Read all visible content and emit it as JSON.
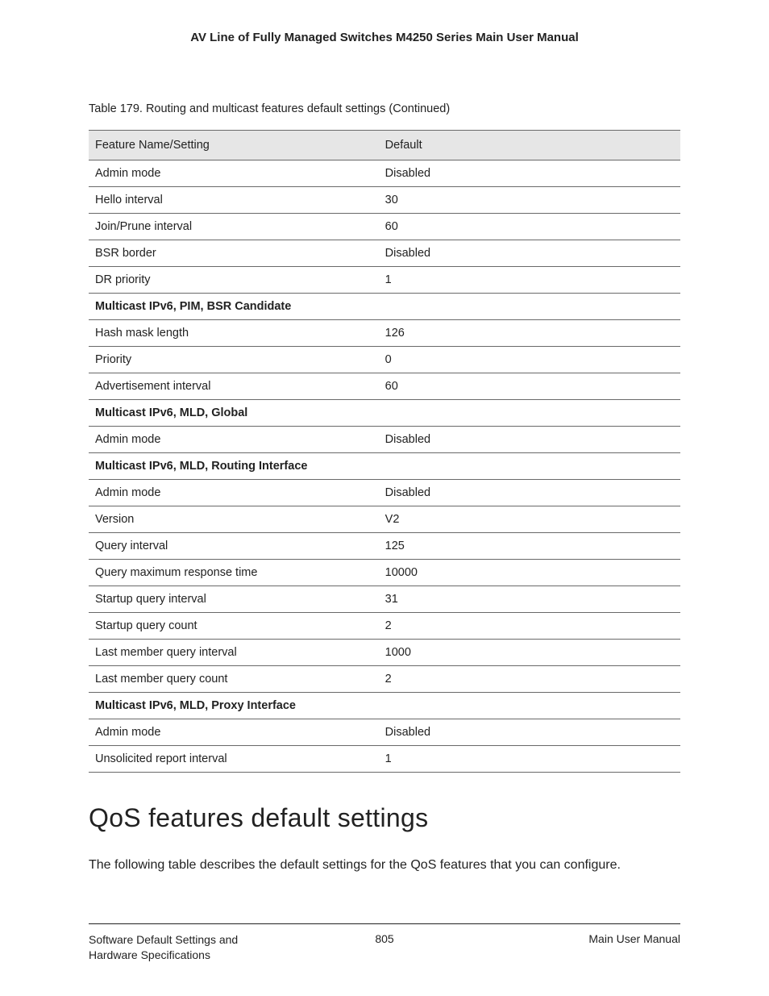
{
  "header": {
    "title": "AV Line of Fully Managed Switches M4250 Series Main User Manual"
  },
  "table": {
    "caption": "Table 179. Routing and multicast features default settings (Continued)",
    "columns": {
      "feature": "Feature Name/Setting",
      "default": "Default"
    },
    "rows": [
      {
        "type": "data",
        "feature": "Admin mode",
        "default": "Disabled"
      },
      {
        "type": "data",
        "feature": "Hello interval",
        "default": "30"
      },
      {
        "type": "data",
        "feature": "Join/Prune interval",
        "default": "60"
      },
      {
        "type": "data",
        "feature": "BSR border",
        "default": "Disabled"
      },
      {
        "type": "data",
        "feature": "DR priority",
        "default": "1"
      },
      {
        "type": "section",
        "feature": "Multicast IPv6, PIM, BSR Candidate",
        "default": ""
      },
      {
        "type": "data",
        "feature": "Hash mask length",
        "default": "126"
      },
      {
        "type": "data",
        "feature": "Priority",
        "default": "0"
      },
      {
        "type": "data",
        "feature": "Advertisement interval",
        "default": "60"
      },
      {
        "type": "section",
        "feature": "Multicast IPv6, MLD, Global",
        "default": ""
      },
      {
        "type": "data",
        "feature": "Admin mode",
        "default": "Disabled"
      },
      {
        "type": "section",
        "feature": "Multicast IPv6, MLD, Routing Interface",
        "default": ""
      },
      {
        "type": "data",
        "feature": "Admin mode",
        "default": "Disabled"
      },
      {
        "type": "data",
        "feature": "Version",
        "default": "V2"
      },
      {
        "type": "data",
        "feature": "Query interval",
        "default": "125"
      },
      {
        "type": "data",
        "feature": "Query maximum response time",
        "default": "10000"
      },
      {
        "type": "data",
        "feature": "Startup query interval",
        "default": "31"
      },
      {
        "type": "data",
        "feature": "Startup query count",
        "default": "2"
      },
      {
        "type": "data",
        "feature": "Last member query interval",
        "default": "1000"
      },
      {
        "type": "data",
        "feature": "Last member query count",
        "default": "2"
      },
      {
        "type": "section",
        "feature": "Multicast IPv6, MLD, Proxy Interface",
        "default": ""
      },
      {
        "type": "data",
        "feature": "Admin mode",
        "default": "Disabled"
      },
      {
        "type": "data",
        "feature": "Unsolicited report interval",
        "default": "1"
      }
    ]
  },
  "section": {
    "heading": "QoS features default settings",
    "para": "The following table describes the default settings for the QoS features that you can configure."
  },
  "footer": {
    "left": "Software Default Settings and Hardware Specifications",
    "center": "805",
    "right": "Main User Manual"
  }
}
